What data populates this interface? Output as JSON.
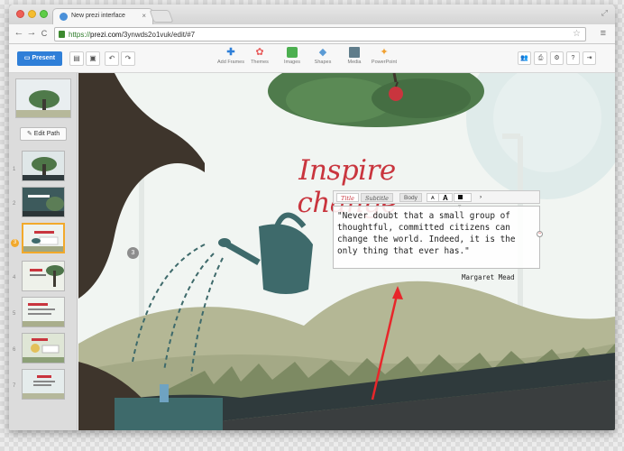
{
  "browser": {
    "tab_title": "New prezi interface",
    "tab_close": "×",
    "url_https": "https://",
    "url_host": "prezi.com",
    "url_path": "/3ynwds2o1vuk/edit/#7",
    "back_icon": "←",
    "forward_icon": "→",
    "reload_icon": "C",
    "star_icon": "☆",
    "menu_icon": "≡",
    "resize_icon": "⤢"
  },
  "toolbar": {
    "present_label": "Present",
    "insert_items": [
      {
        "label": "Add Frames",
        "icon": "plus-icon",
        "color": "#2f7fd8"
      },
      {
        "label": "Themes",
        "icon": "palette-icon",
        "color": "#e85c5c"
      },
      {
        "label": "Images",
        "icon": "image-icon",
        "color": "#4caf50"
      },
      {
        "label": "Shapes",
        "icon": "shapes-icon",
        "color": "#5b9bd5"
      },
      {
        "label": "Media",
        "icon": "film-icon",
        "color": "#607d8b"
      },
      {
        "label": "PowerPoint",
        "icon": "powerpoint-icon",
        "color": "#f0a030"
      }
    ]
  },
  "sidebar": {
    "edit_path_label": "Edit Path",
    "steps": [
      "1",
      "2",
      "3",
      "4",
      "5",
      "6",
      "7"
    ],
    "active_step": "3"
  },
  "canvas": {
    "headline": "Inspire change",
    "format_bar": {
      "title": "Title",
      "subtitle": "Subtitle",
      "body": "Body",
      "small_a": "A",
      "big_a": "A",
      "more": "›"
    },
    "quote": "\"Never doubt that a small group of thoughtful, committed citizens can change the world. Indeed, it is the only thing that ever has.\"",
    "author": "Margaret Mead",
    "frame_number": "3"
  },
  "colors": {
    "accent": "#2f7fd8",
    "headline": "#c9353e",
    "annotation_arrow": "#e8262a"
  }
}
